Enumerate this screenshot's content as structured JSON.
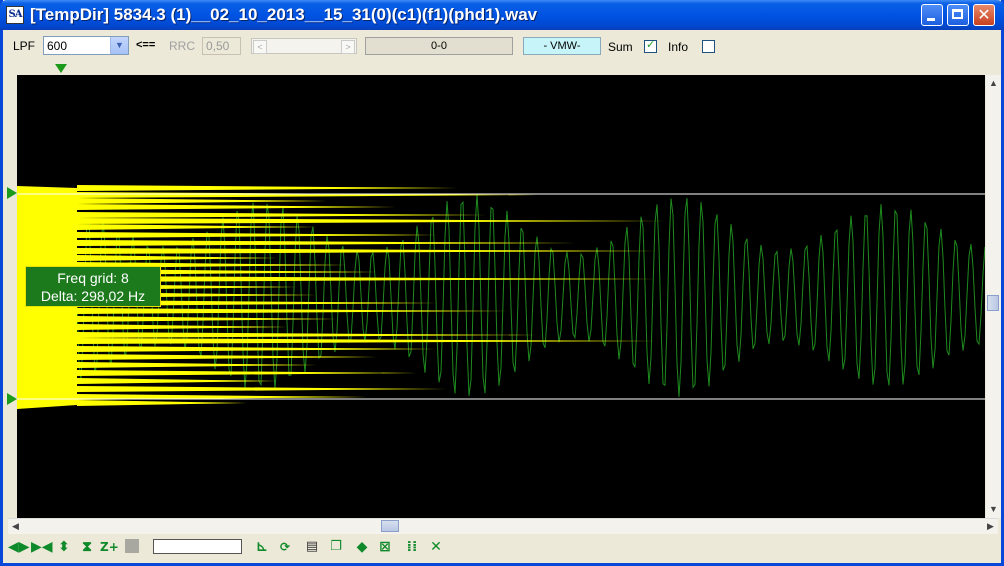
{
  "window": {
    "app_icon_text": "SA",
    "title": "[TempDir] 5834.3 (1)__02_10_2013__15_31(0)(c1)(f1)(phd1).wav",
    "minimize_label": "",
    "maximize_label": "",
    "close_label": "✕"
  },
  "toolbar": {
    "lpf_label": "LPF",
    "lpf_value": "600",
    "arrow_label": "<==",
    "rrc_label": "RRC",
    "rrc_value": "0,50",
    "status_value": "0-0",
    "mode_value": "- VMW-",
    "sum_label": "Sum",
    "sum_checked": true,
    "info_label": "Info",
    "info_checked": false
  },
  "overlay": {
    "freq_grid": "Freq grid: 8",
    "delta": "Delta: 298,02 Hz"
  },
  "colors": {
    "plot_background": "#000000",
    "spectrum_fill": "#ffff00",
    "waveform": "#1e8a1e",
    "grid_line": "#ffffff",
    "marker": "#1c9a1c"
  },
  "bottom_icons": [
    "expand-horizontal-icon",
    "collapse-horizontal-icon",
    "expand-vertical-icon",
    "collapse-vertical-icon",
    "zoom-plus-icon",
    "stop-square-icon",
    "step-icon",
    "refresh-icon",
    "print-icon",
    "copy-icon",
    "diamond-icon",
    "fit-icon",
    "grid-icon",
    "crosshair-icon"
  ]
}
